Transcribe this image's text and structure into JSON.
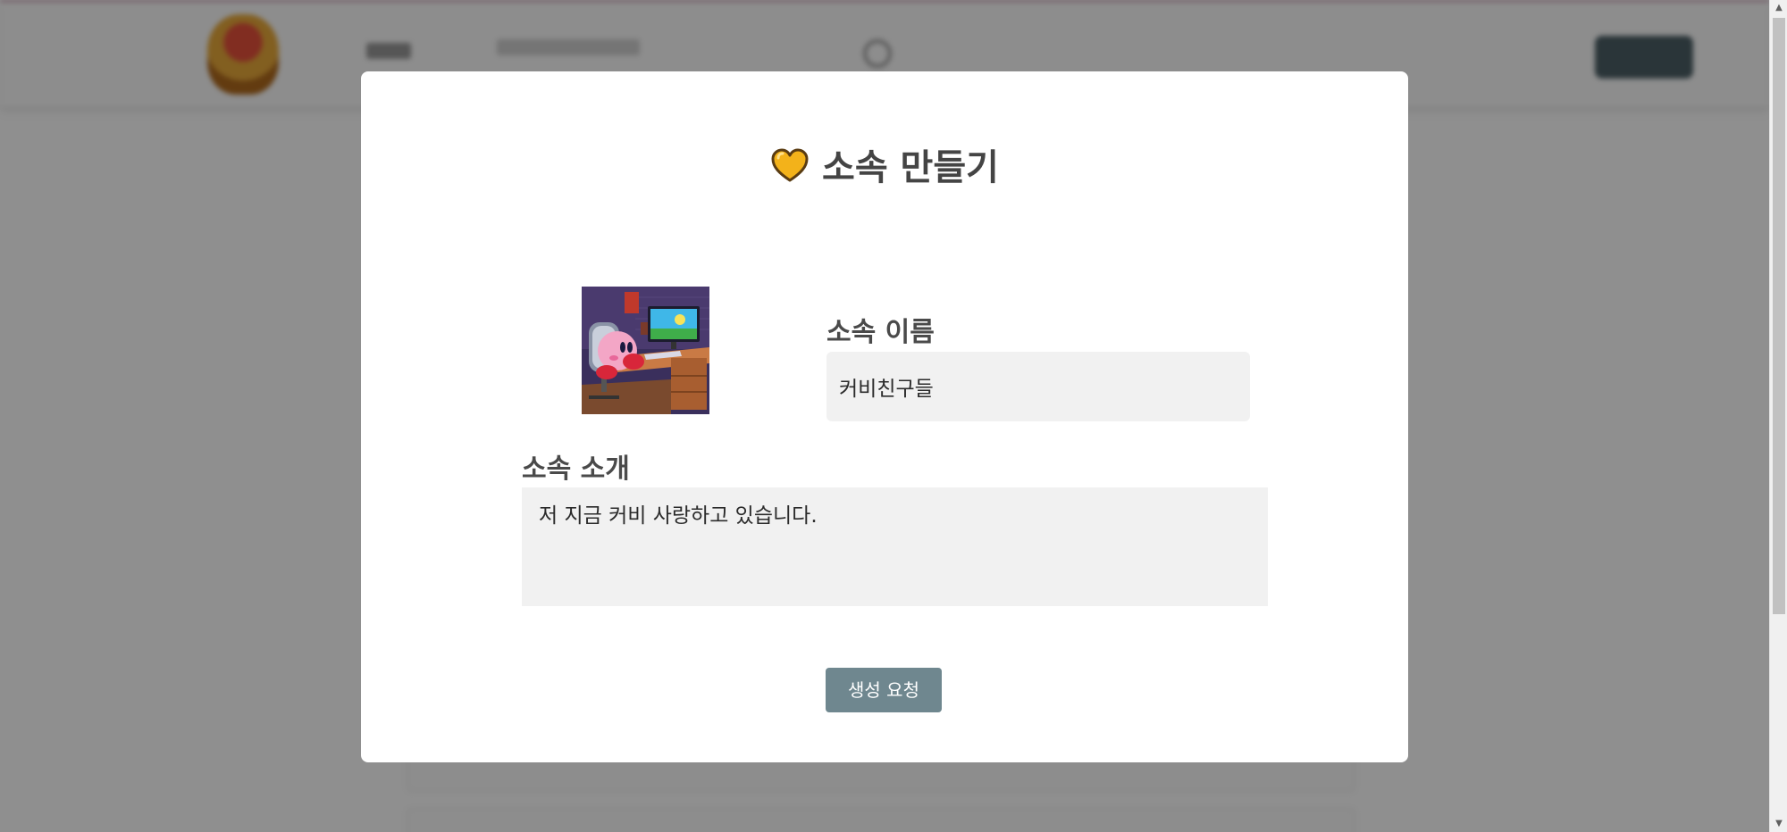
{
  "modal": {
    "title": "소속 만들기",
    "title_icon": "yellow-heart-icon",
    "image": {
      "description_icon": "group-profile-image"
    },
    "name_field": {
      "label": "소속 이름",
      "value": "커비친구들"
    },
    "intro_field": {
      "label": "소속 소개",
      "value": "저 지금 커비 사랑하고 있습니다."
    },
    "submit_label": "생성 요청"
  },
  "colors": {
    "overlay": "#707070",
    "modal_background": "#ffffff",
    "input_background": "#f1f1f1",
    "submit_button": "#6f878f",
    "title_text": "#444444",
    "heart": "#f3b21a"
  }
}
